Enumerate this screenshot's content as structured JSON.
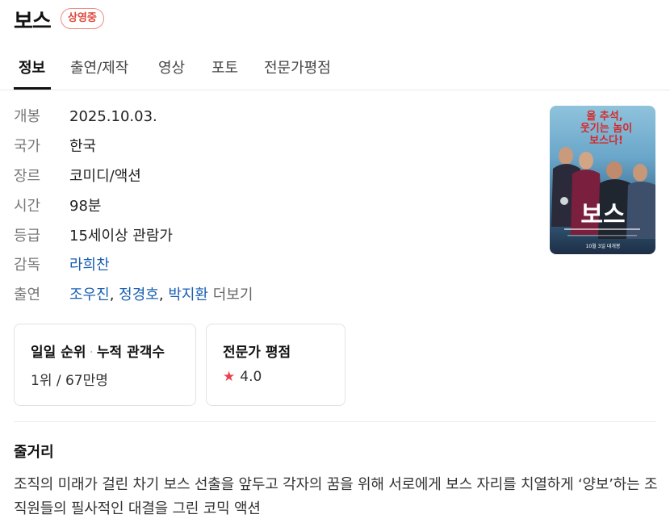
{
  "header": {
    "title": "보스",
    "status_badge": "상영중"
  },
  "tabs": [
    {
      "label": "정보",
      "active": true
    },
    {
      "label": "출연/제작",
      "active": false
    },
    {
      "label": "영상",
      "active": false
    },
    {
      "label": "포토",
      "active": false
    },
    {
      "label": "전문가평점",
      "active": false
    }
  ],
  "info": {
    "release": {
      "label": "개봉",
      "value": "2025.10.03."
    },
    "country": {
      "label": "국가",
      "value": "한국"
    },
    "genre": {
      "label": "장르",
      "value": "코미디/액션"
    },
    "runtime": {
      "label": "시간",
      "value": "98분"
    },
    "rating": {
      "label": "등급",
      "value": "15세이상 관람가"
    },
    "director": {
      "label": "감독",
      "value": "라희찬"
    },
    "cast": {
      "label": "출연",
      "actors": [
        "조우진",
        "정경호",
        "박지환"
      ],
      "separator": ",",
      "more_label": "더보기"
    }
  },
  "poster": {
    "headline_lines": [
      "올 추석,",
      "웃기는 놈이",
      "보스다!"
    ],
    "logo_text": "보스",
    "date_text": "10월 3일 대개봉"
  },
  "cards": {
    "box_office": {
      "title_rank": "일일 순위",
      "title_dot": "·",
      "title_audience": "누적 관객수",
      "value": "1위 / 67만명"
    },
    "critic": {
      "title": "전문가 평점",
      "star_icon": "★",
      "score": "4.0"
    }
  },
  "synopsis": {
    "title": "줄거리",
    "text": "조직의 미래가 걸린 차기 보스 선출을 앞두고 각자의 꿈을 위해 서로에게 보스 자리를 치열하게 ‘양보’하는 조직원들의 필사적인 대결을 그린 코믹 액션"
  },
  "colors": {
    "accent_link": "#1a5fb4",
    "badge_red": "#e0473b",
    "star_red": "#e8414f"
  }
}
